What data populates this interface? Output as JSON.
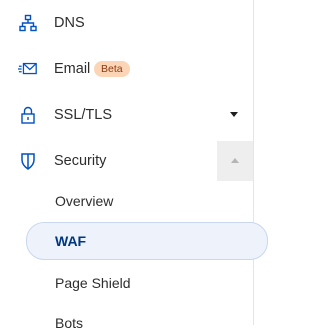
{
  "nav": {
    "dns": {
      "label": "DNS",
      "icon": "network-icon"
    },
    "email": {
      "label": "Email",
      "badge": "Beta",
      "icon": "envelope-icon"
    },
    "ssl": {
      "label": "SSL/TLS",
      "icon": "lock-icon",
      "chevron": "chevron-down-icon"
    },
    "security": {
      "label": "Security",
      "icon": "shield-icon",
      "chevron": "chevron-up-icon",
      "subitems": [
        {
          "label": "Overview"
        },
        {
          "label": "WAF",
          "active": true
        },
        {
          "label": "Page Shield"
        },
        {
          "label": "Bots"
        }
      ]
    }
  },
  "colors": {
    "icon": "#0051c3",
    "active_text": "#003681",
    "active_bg": "#eef3fb",
    "badge_bg": "#fbd5b6"
  }
}
